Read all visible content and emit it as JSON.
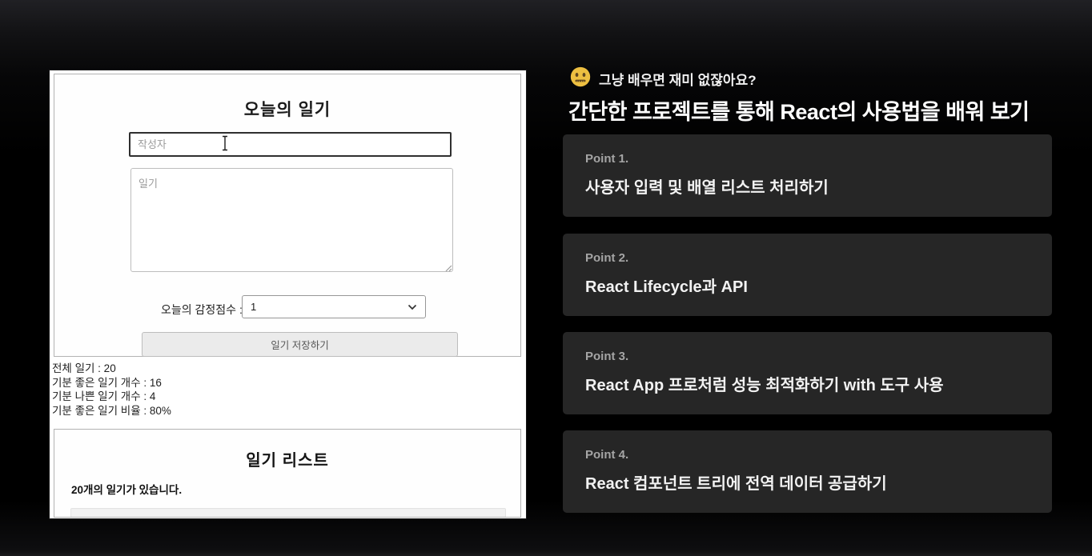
{
  "left_app": {
    "editor": {
      "title": "오늘의 일기",
      "author_placeholder": "작성자",
      "diary_placeholder": "일기",
      "emotion_label": "오늘의 감정점수 :",
      "emotion_value": "1",
      "save_button": "일기 저장하기"
    },
    "stats": {
      "lines": [
        "전체 일기 : 20",
        "기분 좋은 일기 개수 : 16",
        "기분 나쁜 일기 개수 : 4",
        "기분 좋은 일기 비율 : 80%"
      ]
    },
    "list": {
      "title": "일기 리스트",
      "count_number": "20",
      "count_suffix": "개의 일기가 있습니다."
    }
  },
  "right_slide": {
    "emoji": "neutral-face",
    "intro": "그냥 배우면 재미 없잖아요?",
    "heading": "간단한 프로젝트를 통해 React의 사용법을 배워 보기",
    "points": [
      {
        "label": "Point 1.",
        "text": "사용자 입력 및 배열 리스트 처리하기"
      },
      {
        "label": "Point 2.",
        "text": "React Lifecycle과 API"
      },
      {
        "label": "Point 3.",
        "text": "React App 프로처럼 성능 최적화하기 with 도구 사용"
      },
      {
        "label": "Point 4.",
        "text": "React 컴포넌트 트리에 전역 데이터 공급하기"
      }
    ]
  },
  "colors": {
    "background_top": "#202024",
    "background": "#000000",
    "card_background": "#262626",
    "card_label": "#a5a5a5",
    "card_text": "#f2f2f2",
    "emoji_yellow": "#edbf41",
    "button_background": "#ebebeb"
  }
}
